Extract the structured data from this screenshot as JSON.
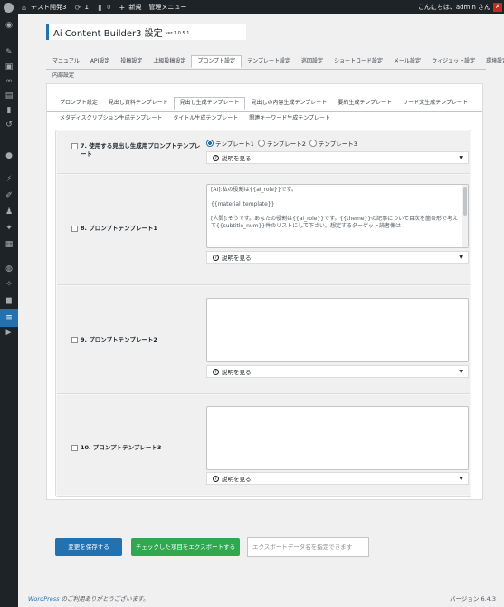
{
  "adminbar": {
    "site_name": "テスト開発3",
    "updates_count": "1",
    "comments_count": "0",
    "new_label": "新規",
    "admin_menu": "管理メニュー",
    "greeting": "こんにちは、admin さん"
  },
  "header": {
    "title": "Ai Content Builder3 設定",
    "version": "ver.1.0.5.1"
  },
  "main_tabs": [
    {
      "label": "マニュアル"
    },
    {
      "label": "API設定"
    },
    {
      "label": "投稿設定"
    },
    {
      "label": "上級投稿設定"
    },
    {
      "label": "プロンプト設定",
      "active": true
    },
    {
      "label": "テンプレート設定"
    },
    {
      "label": "巡回設定"
    },
    {
      "label": "ショートコード設定"
    },
    {
      "label": "メール設定"
    },
    {
      "label": "ウィジェット設定"
    },
    {
      "label": "環境設定"
    },
    {
      "label": "内部設定"
    }
  ],
  "sub_tabs": [
    {
      "label": "プロンプト設定"
    },
    {
      "label": "見出し資料テンプレート"
    },
    {
      "label": "見出し生成テンプレート",
      "active": true
    },
    {
      "label": "見出しの内容生成テンプレート"
    },
    {
      "label": "要約生成テンプレート"
    },
    {
      "label": "リード文生成テンプレート"
    },
    {
      "label": "メタディスクリプション生成テンプレート"
    },
    {
      "label": "タイトル生成テンプレート"
    },
    {
      "label": "関連キーワード生成テンプレート"
    }
  ],
  "rows": {
    "use_template": {
      "label": "7. 使用する見出し生成用プロンプトテンプレート",
      "options": [
        "テンプレート1",
        "テンプレート2",
        "テンプレート3"
      ],
      "selected": "テンプレート1",
      "explain": "説明を見る"
    },
    "template1": {
      "label": "8. プロンプトテンプレート1",
      "text_lines": [
        "[AI]:私の役割は{{ai_role}}です。",
        "",
        "{{material_template}}",
        "",
        "[人間]:そうです。あなたの役割は{{ai_role}}です。{{theme}}の記事について目次を箇条形で考えて{{subtitle_num}}件のリストにして下さい。想定するターゲット読者像は"
      ],
      "explain": "説明を見る"
    },
    "template2": {
      "label": "9. プロンプトテンプレート2",
      "explain": "説明を見る"
    },
    "template3": {
      "label": "10. プロンプトテンプレート3",
      "explain": "説明を見る"
    }
  },
  "actions": {
    "save_label": "変更を保存する",
    "export_label": "チェックした項目をエクスポートする",
    "export_placeholder": "エクスポートデータ名を指定できます"
  },
  "footer": {
    "wordpress_link": "WordPress",
    "thanks": " のご利用ありがとうございます。",
    "version": "バージョン 6.4.3"
  },
  "colors": {
    "accent": "#2271b1",
    "export_button": "#2fa84f",
    "adminbar": "#1d2327"
  }
}
